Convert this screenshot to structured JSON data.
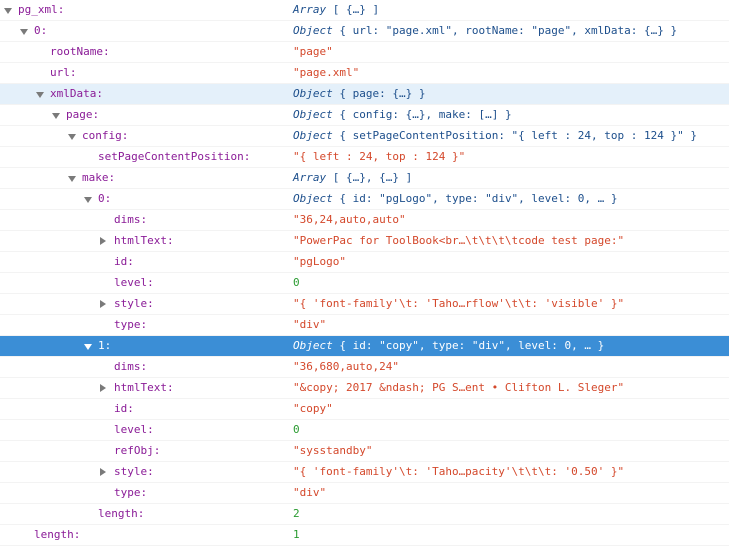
{
  "rows": [
    {
      "key": "pg_xml:",
      "value": "[ {…} ]",
      "label": "Array",
      "kind": "object",
      "toggle": "open",
      "state": ""
    },
    {
      "key": "0:",
      "value": "{ url: \"page.xml\", rootName: \"page\", xmlData: {…} }",
      "label": "Object",
      "kind": "object",
      "toggle": "open",
      "state": ""
    },
    {
      "key": "rootName:",
      "value": "\"page\"",
      "kind": "string",
      "toggle": "",
      "state": ""
    },
    {
      "key": "url:",
      "value": "\"page.xml\"",
      "kind": "string",
      "toggle": "",
      "state": ""
    },
    {
      "key": "xmlData:",
      "value": "{ page: {…} }",
      "label": "Object",
      "kind": "object",
      "toggle": "open",
      "state": "hover"
    },
    {
      "key": "page:",
      "value": "{ config: {…}, make: […] }",
      "label": "Object",
      "kind": "object",
      "toggle": "open",
      "state": ""
    },
    {
      "key": "config:",
      "value": "{ setPageContentPosition: \"{ left : 24, top : 124 }\" }",
      "label": "Object",
      "kind": "object",
      "toggle": "open",
      "state": ""
    },
    {
      "key": "setPageContentPosition:",
      "value": "\"{ left : 24, top : 124 }\"",
      "kind": "string",
      "toggle": "",
      "state": ""
    },
    {
      "key": "make:",
      "value": "[ {…}, {…} ]",
      "label": "Array",
      "kind": "object",
      "toggle": "open",
      "state": ""
    },
    {
      "key": "0:",
      "value": "{ id: \"pgLogo\", type: \"div\", level: 0, … }",
      "label": "Object",
      "kind": "object",
      "toggle": "open",
      "state": ""
    },
    {
      "key": "dims:",
      "value": "\"36,24,auto,auto\"",
      "kind": "string",
      "toggle": "",
      "state": ""
    },
    {
      "key": "htmlText:",
      "value": "\"PowerPac for ToolBook<br…\\t\\t\\t\\tcode test page:\"",
      "kind": "string",
      "toggle": "closed",
      "state": ""
    },
    {
      "key": "id:",
      "value": "\"pgLogo\"",
      "kind": "string",
      "toggle": "",
      "state": ""
    },
    {
      "key": "level:",
      "value": "0",
      "kind": "number",
      "toggle": "",
      "state": ""
    },
    {
      "key": "style:",
      "value": "\"{ 'font-family'\\t: 'Taho…rflow'\\t\\t: 'visible' }\"",
      "kind": "string",
      "toggle": "closed",
      "state": ""
    },
    {
      "key": "type:",
      "value": "\"div\"",
      "kind": "string",
      "toggle": "",
      "state": ""
    },
    {
      "key": "1:",
      "value": "{ id: \"copy\", type: \"div\", level: 0, … }",
      "label": "Object",
      "kind": "object",
      "toggle": "open",
      "state": "selected"
    },
    {
      "key": "dims:",
      "value": "\"36,680,auto,24\"",
      "kind": "string",
      "toggle": "",
      "state": ""
    },
    {
      "key": "htmlText:",
      "value": "\"&copy; 2017 &ndash; PG S…ent • Clifton L. Sleger\"",
      "kind": "string",
      "toggle": "closed",
      "state": ""
    },
    {
      "key": "id:",
      "value": "\"copy\"",
      "kind": "string",
      "toggle": "",
      "state": ""
    },
    {
      "key": "level:",
      "value": "0",
      "kind": "number",
      "toggle": "",
      "state": ""
    },
    {
      "key": "refObj:",
      "value": "\"sysstandby\"",
      "kind": "string",
      "toggle": "",
      "state": ""
    },
    {
      "key": "style:",
      "value": "\"{ 'font-family'\\t: 'Taho…pacity'\\t\\t\\t: '0.50' }\"",
      "kind": "string",
      "toggle": "closed",
      "state": ""
    },
    {
      "key": "type:",
      "value": "\"div\"",
      "kind": "string",
      "toggle": "",
      "state": ""
    },
    {
      "key": "length:",
      "value": "2",
      "kind": "number",
      "toggle": "",
      "state": ""
    },
    {
      "key": "length:",
      "value": "1",
      "kind": "number",
      "toggle": "",
      "state": ""
    }
  ]
}
